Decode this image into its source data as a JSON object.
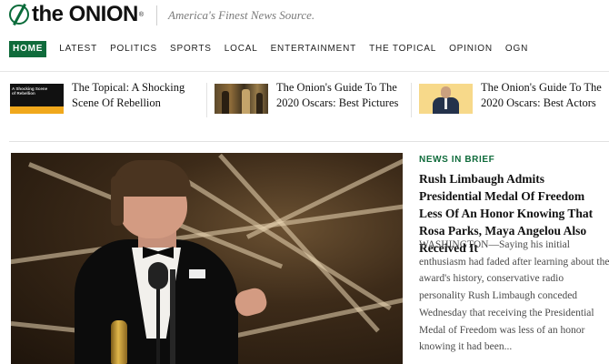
{
  "header": {
    "logo_text": "the ONION",
    "logo_reg": "®",
    "logo_icon": "onion-slash-logo-icon",
    "tagline": "America's Finest News Source."
  },
  "nav": {
    "items": [
      {
        "label": "HOME",
        "active": true
      },
      {
        "label": "LATEST"
      },
      {
        "label": "POLITICS"
      },
      {
        "label": "SPORTS"
      },
      {
        "label": "LOCAL"
      },
      {
        "label": "ENTERTAINMENT"
      },
      {
        "label": "THE TOPICAL"
      },
      {
        "label": "OPINION"
      },
      {
        "label": "OGN"
      }
    ],
    "active_color": "#0f6b3b"
  },
  "top_stories": [
    {
      "title": "The Topical: A Shocking Scene Of Rebellion",
      "thumb_text": "A Shocking Scene of Rebellion"
    },
    {
      "title": "The Onion's Guide To The 2020 Oscars: Best Pictures"
    },
    {
      "title": "The Onion's Guide To The 2020 Oscars: Best Actors"
    }
  ],
  "feature": {
    "category": "NEWS IN BRIEF",
    "headline": "Rush Limbaugh Admits Presidential Medal Of Freedom Less Of An Honor Knowing That Rosa Parks, Maya Angelou Also Received It",
    "body": "WASHINGTON—Saying his initial enthusiasm had faded after learning about the award's history, conservative radio personality Rush Limbaugh conceded Wednesday that receiving the Presidential Medal of Freedom was less of an honor knowing it had been..."
  },
  "colors": {
    "brand_green": "#0f6b3b",
    "tagline_gray": "#7a7a7a"
  }
}
